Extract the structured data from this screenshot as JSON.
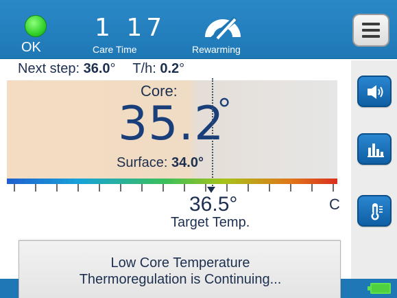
{
  "header": {
    "status": {
      "text": "OK",
      "color": "#33d12b"
    },
    "care_time": {
      "value": "1 17",
      "label": "Care Time"
    },
    "mode": {
      "label": "Rewarming",
      "icon": "gauge-icon"
    },
    "menu_icon": "hamburger-menu-icon"
  },
  "next_step": {
    "label": "Next step:",
    "value": "36.0",
    "deg": "°",
    "rate_label": "T/h:",
    "rate_value": "0.2",
    "rate_deg": "°"
  },
  "core": {
    "label": "Core:",
    "value": "35.2",
    "deg": "°"
  },
  "surface": {
    "label": "Surface:",
    "value": "34.0",
    "deg": "°"
  },
  "target": {
    "value": "36.5",
    "deg": "°",
    "unit": "C",
    "label": "Target Temp."
  },
  "sidebar": {
    "buttons": [
      {
        "icon": "speaker-icon"
      },
      {
        "icon": "bar-chart-icon"
      },
      {
        "icon": "thermometer-icon"
      }
    ]
  },
  "alert": {
    "line1": "Low Core Temperature",
    "line2": "Thermoregulation is Continuing..."
  },
  "colors": {
    "header": "#1f78b6",
    "accent_button": "#1a6fb8",
    "text": "#1d2f4f"
  },
  "battery": {
    "icon": "battery-icon",
    "color": "#4fd13f"
  }
}
